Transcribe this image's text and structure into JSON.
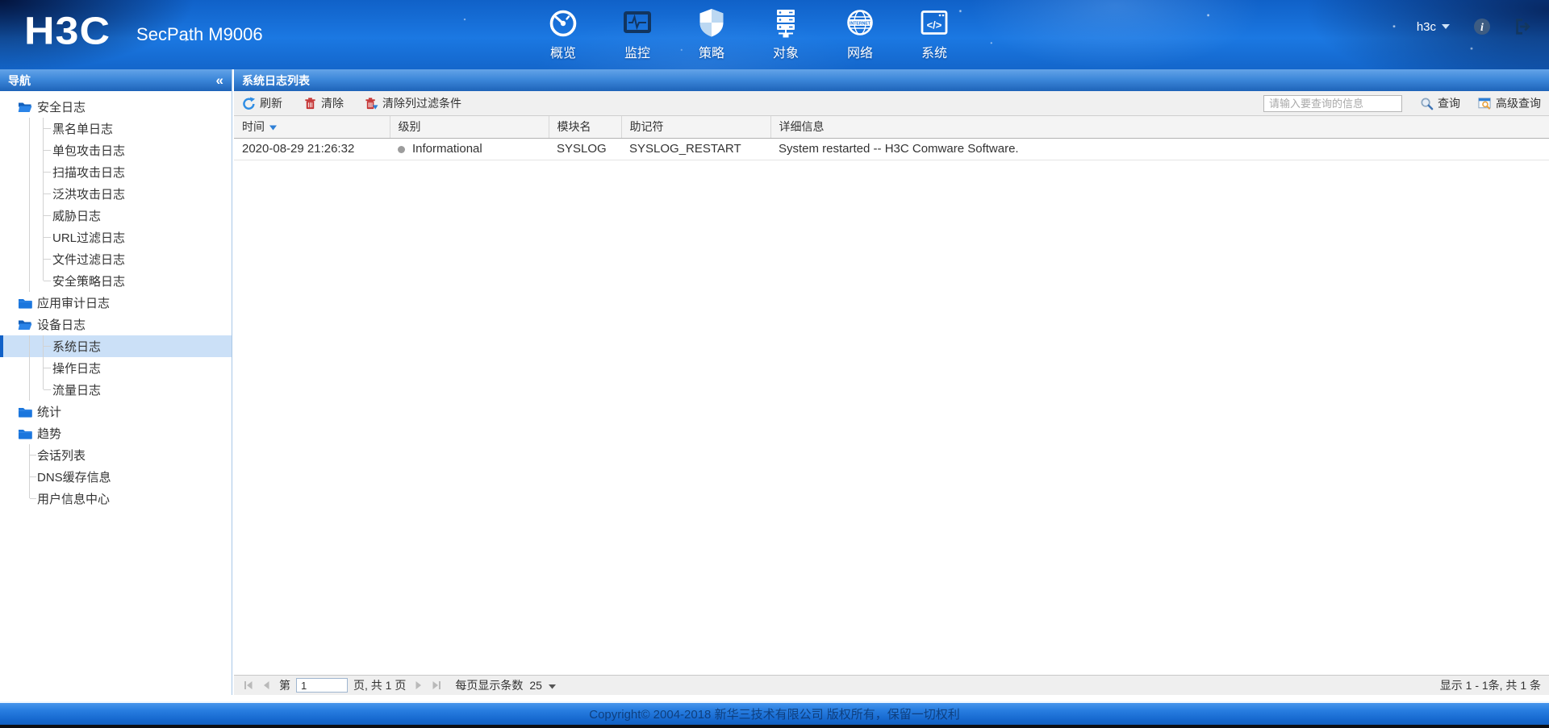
{
  "banner": {
    "logo_text": "H3C",
    "product_name": "SecPath M9006",
    "username": "h3c",
    "nav_items": [
      {
        "name": "overview",
        "label": "概览",
        "icon": "gauge-icon"
      },
      {
        "name": "monitor",
        "label": "监控",
        "icon": "monitor-icon"
      },
      {
        "name": "policy",
        "label": "策略",
        "icon": "shield-icon"
      },
      {
        "name": "objects",
        "label": "对象",
        "icon": "objects-icon"
      },
      {
        "name": "network",
        "label": "网络",
        "icon": "globe-icon"
      },
      {
        "name": "system",
        "label": "系统",
        "icon": "code-icon"
      }
    ]
  },
  "sidebar": {
    "header_title": "导航",
    "collapse_glyph": "«",
    "tree": [
      {
        "name": "security-log",
        "label": "安全日志",
        "type": "folder-open"
      },
      {
        "name": "blacklist-log",
        "label": "黑名单日志",
        "type": "child"
      },
      {
        "name": "single-packet-attack-log",
        "label": "单包攻击日志",
        "type": "child"
      },
      {
        "name": "scan-attack-log",
        "label": "扫描攻击日志",
        "type": "child"
      },
      {
        "name": "flood-attack-log",
        "label": "泛洪攻击日志",
        "type": "child"
      },
      {
        "name": "threat-log",
        "label": "威胁日志",
        "type": "child"
      },
      {
        "name": "url-filter-log",
        "label": "URL过滤日志",
        "type": "child"
      },
      {
        "name": "file-filter-log",
        "label": "文件过滤日志",
        "type": "child"
      },
      {
        "name": "security-policy-log",
        "label": "安全策略日志",
        "type": "child",
        "last": true
      },
      {
        "name": "app-audit-log",
        "label": "应用审计日志",
        "type": "folder-closed"
      },
      {
        "name": "device-log",
        "label": "设备日志",
        "type": "folder-open"
      },
      {
        "name": "system-log",
        "label": "系统日志",
        "type": "child",
        "selected": true
      },
      {
        "name": "operation-log",
        "label": "操作日志",
        "type": "child"
      },
      {
        "name": "traffic-log",
        "label": "流量日志",
        "type": "child",
        "last": true
      },
      {
        "name": "statistics",
        "label": "统计",
        "type": "folder-closed"
      },
      {
        "name": "trend",
        "label": "趋势",
        "type": "folder-closed"
      },
      {
        "name": "session-list",
        "label": "会话列表",
        "type": "root-leaf"
      },
      {
        "name": "dns-cache-info",
        "label": "DNS缓存信息",
        "type": "root-leaf"
      },
      {
        "name": "user-info-center",
        "label": "用户信息中心",
        "type": "root-leaf",
        "last": true
      }
    ]
  },
  "content": {
    "title": "系统日志列表",
    "toolbar": {
      "refresh": "刷新",
      "clear": "清除",
      "clear_filter": "清除列过滤条件",
      "search_placeholder": "请输入要查询的信息",
      "query": "查询",
      "advanced_query": "高级查询"
    },
    "table": {
      "columns": [
        {
          "name": "time",
          "label": "时间",
          "sorted": true
        },
        {
          "name": "level",
          "label": "级别"
        },
        {
          "name": "module",
          "label": "模块名"
        },
        {
          "name": "mnemonic",
          "label": "助记符"
        },
        {
          "name": "detail",
          "label": "详细信息"
        }
      ],
      "rows": [
        {
          "time": "2020-08-29 21:26:32",
          "level": "Informational",
          "module": "SYSLOG",
          "mnemonic": "SYSLOG_RESTART",
          "detail": "System restarted -- H3C Comware Software."
        }
      ]
    },
    "pagination": {
      "page_prefix": "第",
      "page_value": "1",
      "page_suffix": "页, 共 1 页",
      "per_page_label": "每页显示条数",
      "per_page_value": "25",
      "summary": "显示 1 - 1条, 共 1 条"
    }
  },
  "footer": {
    "copyright": "Copyright© 2004-2018 新华三技术有限公司 版权所有，保留一切权利"
  },
  "colors": {
    "banner_blue": "#1a72d8",
    "pane_header_top": "#63a3e8",
    "pane_header_bottom": "#1e63b8",
    "selected_bg": "#cbe0f7",
    "selected_bar": "#1161c8",
    "danger_red": "#c43131",
    "refresh_blue": "#2e8de4",
    "level_dot_gray": "#9c9c9c",
    "footer_blue": "#1668cf"
  }
}
